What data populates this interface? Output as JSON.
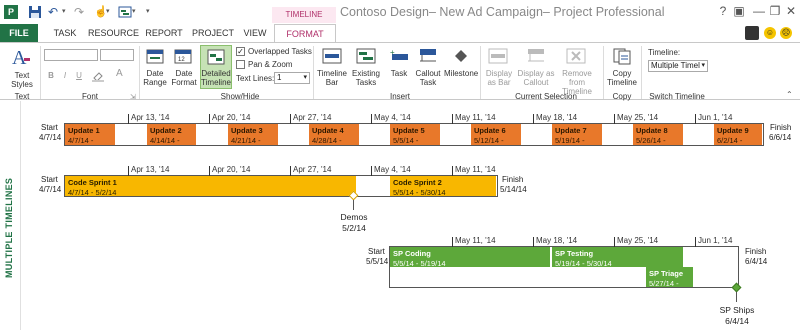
{
  "window": {
    "title": "Contoso Design– New Ad Campaign– Project Professional",
    "context_group": "TIMELINE TOOLS"
  },
  "tabs": [
    "FILE",
    "TASK",
    "RESOURCE",
    "REPORT",
    "PROJECT",
    "VIEW",
    "FORMAT"
  ],
  "ribbon": {
    "text_styles": "Text Styles",
    "font_group": "Font",
    "date_range": "Date Range",
    "date_format": "Date Format",
    "detailed_timeline": "Detailed Timeline",
    "overlapped_tasks": "Overlapped Tasks",
    "pan_zoom": "Pan & Zoom",
    "text_lines_label": "Text Lines:",
    "text_lines_value": "1",
    "show_hide_group": "Show/Hide",
    "timeline_bar": "Timeline Bar",
    "existing_tasks": "Existing Tasks",
    "task": "Task",
    "callout_task": "Callout Task",
    "milestone": "Milestone",
    "insert_group": "Insert",
    "display_as_bar": "Display as Bar",
    "display_as_callout": "Display as Callout",
    "remove_from_timeline": "Remove from Timeline",
    "current_selection_group": "Current Selection",
    "copy_timeline": "Copy Timeline",
    "copy_group": "Copy",
    "timeline_label": "Timeline:",
    "timeline_value": "Multiple Timel",
    "switch_timeline_group": "Switch Timeline",
    "text_group": "Text",
    "bold": "B",
    "italic": "I",
    "underline": "U"
  },
  "side_label": "MULTIPLE TIMELINES",
  "timeline1": {
    "start_label": "Start",
    "start_date": "4/7/14",
    "finish_label": "Finish",
    "finish_date": "6/6/14",
    "ticks": [
      "Apr 13, '14",
      "Apr 20, '14",
      "Apr 27, '14",
      "May 4, '14",
      "May 11, '14",
      "May 18, '14",
      "May 25, '14",
      "Jun 1, '14"
    ],
    "tasks": [
      {
        "name": "Update 1",
        "date": "4/7/14 -"
      },
      {
        "name": "Update 2",
        "date": "4/14/14 -"
      },
      {
        "name": "Update 3",
        "date": "4/21/14 -"
      },
      {
        "name": "Update 4",
        "date": "4/28/14 -"
      },
      {
        "name": "Update 5",
        "date": "5/5/14 -"
      },
      {
        "name": "Update 6",
        "date": "5/12/14 -"
      },
      {
        "name": "Update 7",
        "date": "5/19/14 -"
      },
      {
        "name": "Update 8",
        "date": "5/26/14 -"
      },
      {
        "name": "Update 9",
        "date": "6/2/14 -"
      }
    ]
  },
  "timeline2": {
    "start_label": "Start",
    "start_date": "4/7/14",
    "finish_label": "Finish",
    "finish_date": "5/14/14",
    "ticks": [
      "Apr 13, '14",
      "Apr 20, '14",
      "Apr 27, '14",
      "May 4, '14",
      "May 11, '14"
    ],
    "tasks": [
      {
        "name": "Code Sprint 1",
        "date": "4/7/14 - 5/2/14"
      },
      {
        "name": "Code Sprint 2",
        "date": "5/5/14 - 5/30/14"
      }
    ],
    "milestone": {
      "name": "Demos",
      "date": "5/2/14"
    }
  },
  "timeline3": {
    "start_label": "Start",
    "start_date": "5/5/14",
    "finish_label": "Finish",
    "finish_date": "6/4/14",
    "ticks": [
      "May 11, '14",
      "May 18, '14",
      "May 25, '14",
      "Jun 1, '14"
    ],
    "tasks": [
      {
        "name": "SP Coding",
        "date": "5/5/14 - 5/19/14"
      },
      {
        "name": "SP Testing",
        "date": "5/19/14 - 5/30/14"
      },
      {
        "name": "SP Triage",
        "date": "5/27/14 -"
      }
    ],
    "milestone": {
      "name": "SP Ships",
      "date": "6/4/14"
    }
  },
  "colors": {
    "file_tab": "#217346",
    "orange": "#e8782a",
    "gold": "#f8b700",
    "green": "#5da83a",
    "format_tab": "#b0306a"
  }
}
